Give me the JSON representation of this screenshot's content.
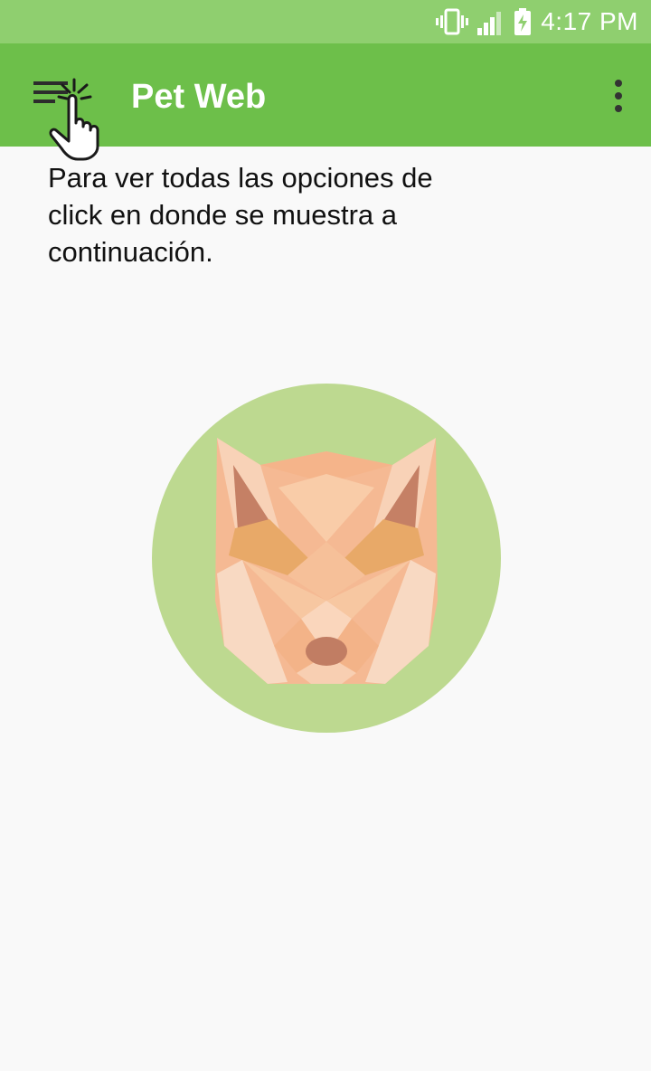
{
  "status_bar": {
    "time": "4:17 PM",
    "icons": [
      "vibrate-icon",
      "signal-icon",
      "battery-charging-icon"
    ]
  },
  "app_bar": {
    "title": "Pet Web",
    "menu_icon": "hamburger-menu-icon",
    "overflow_icon": "more-vert-icon",
    "pointer_icon": "tap-hand-icon"
  },
  "main": {
    "instruction": "Para ver todas las opciones de click en donde se muestra a continuación."
  },
  "logo": {
    "icon": "fox-head-icon"
  },
  "colors": {
    "status_bar": "#8fcf6f",
    "app_bar": "#6dbf4a",
    "background": "#f9f9f9",
    "logo_circle": "#bdd990"
  }
}
